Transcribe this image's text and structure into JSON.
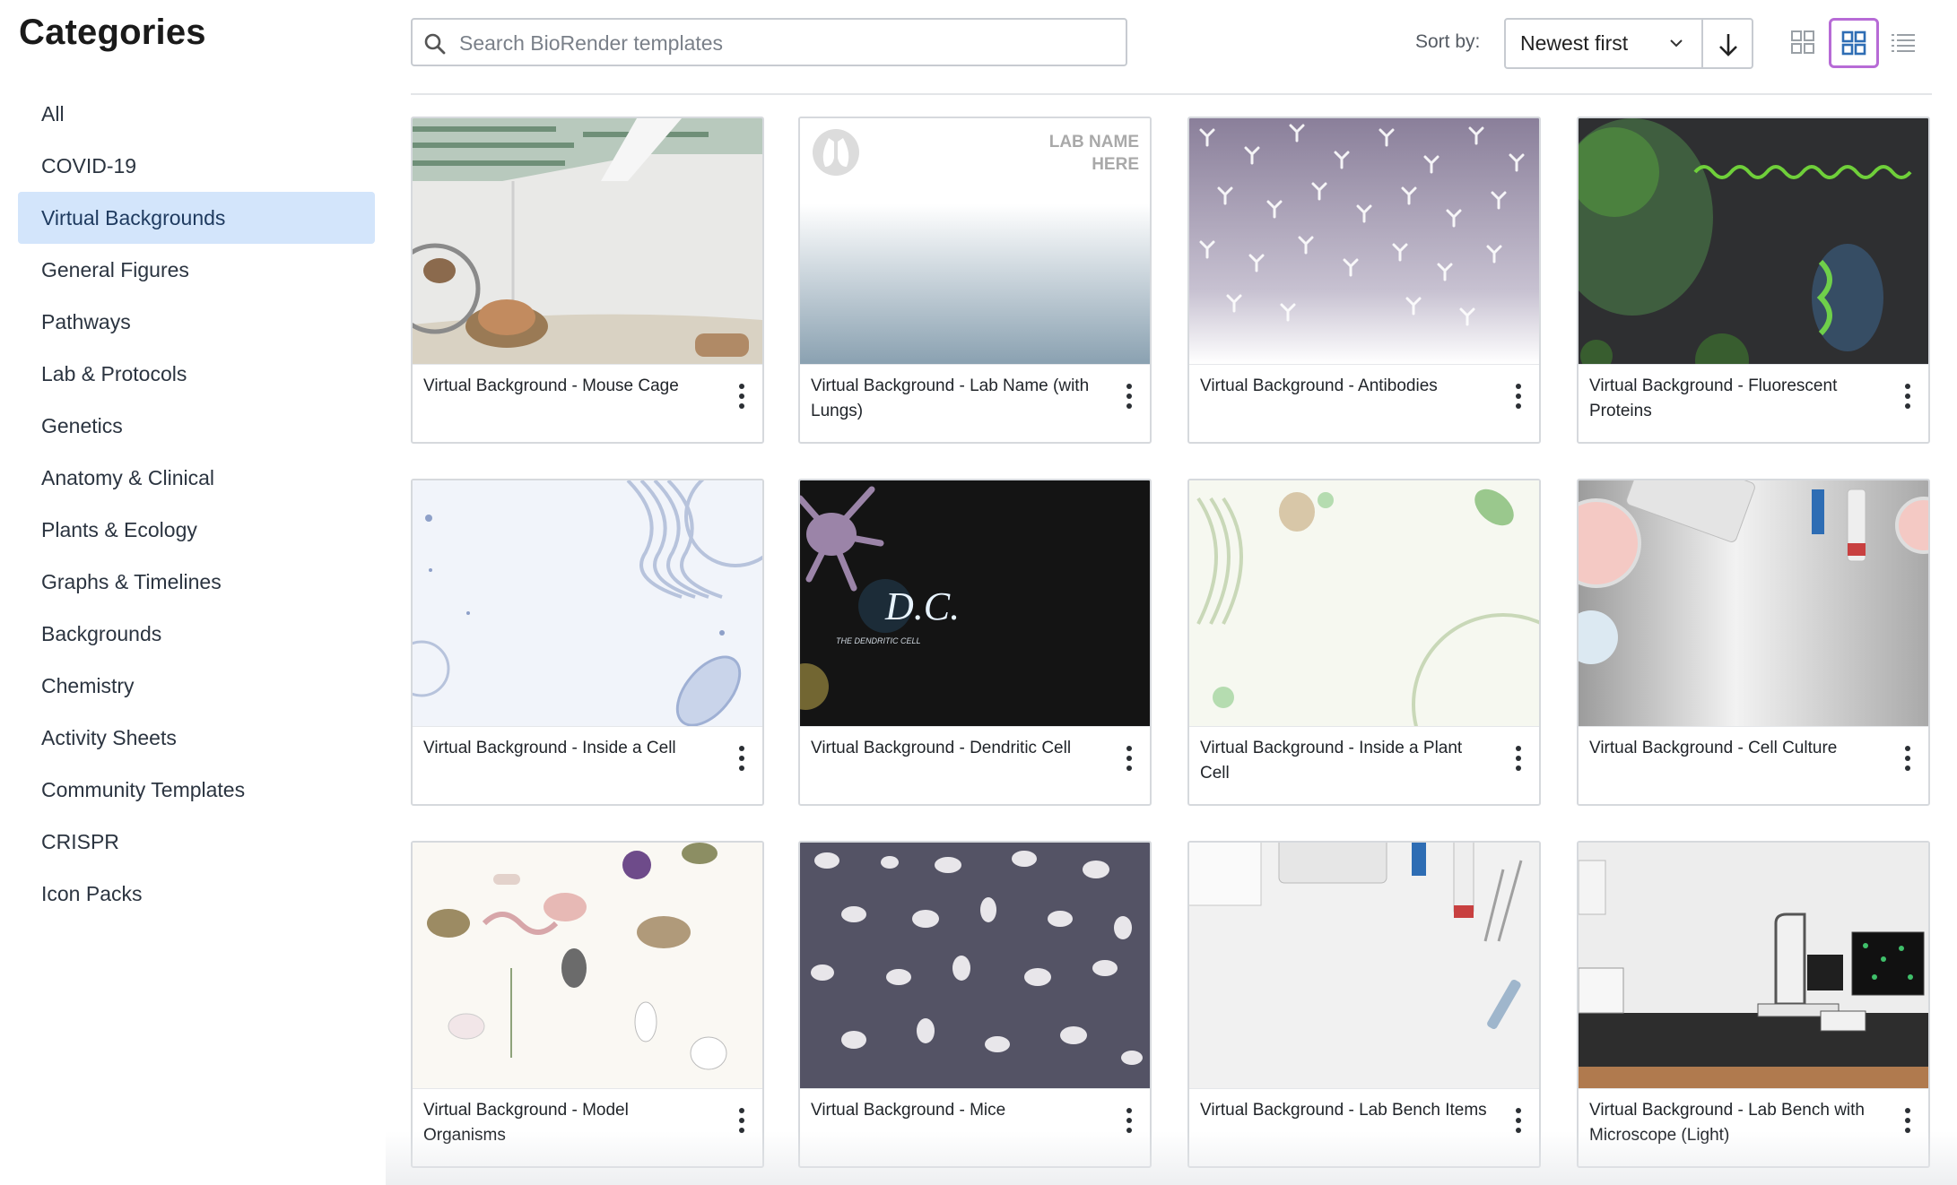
{
  "sidebar": {
    "title": "Categories",
    "items": [
      {
        "label": "All",
        "active": false
      },
      {
        "label": "COVID-19",
        "active": false
      },
      {
        "label": "Virtual Backgrounds",
        "active": true
      },
      {
        "label": "General Figures",
        "active": false
      },
      {
        "label": "Pathways",
        "active": false
      },
      {
        "label": "Lab & Protocols",
        "active": false
      },
      {
        "label": "Genetics",
        "active": false
      },
      {
        "label": "Anatomy & Clinical",
        "active": false
      },
      {
        "label": "Plants & Ecology",
        "active": false
      },
      {
        "label": "Graphs & Timelines",
        "active": false
      },
      {
        "label": "Backgrounds",
        "active": false
      },
      {
        "label": "Chemistry",
        "active": false
      },
      {
        "label": "Activity Sheets",
        "active": false
      },
      {
        "label": "Community Templates",
        "active": false
      },
      {
        "label": "CRISPR",
        "active": false
      },
      {
        "label": "Icon Packs",
        "active": false
      }
    ]
  },
  "toolbar": {
    "search_placeholder": "Search BioRender templates",
    "search_value": "",
    "sort_label": "Sort by:",
    "sort_value": "Newest first",
    "sort_direction": "descending",
    "view_modes": [
      "small-grid",
      "large-grid",
      "list"
    ],
    "active_view": "large-grid",
    "accent_color": "#b76bd6"
  },
  "templates": [
    {
      "title": "Virtual Background - Mouse Cage",
      "thumb": "mouse-cage"
    },
    {
      "title": "Virtual Background - Lab Name (with Lungs)",
      "thumb": "lab-name",
      "thumb_text": "LAB NAME HERE"
    },
    {
      "title": "Virtual Background - Antibodies",
      "thumb": "antibodies"
    },
    {
      "title": "Virtual Background - Fluorescent Proteins",
      "thumb": "fluorescent"
    },
    {
      "title": "Virtual Background - Inside a Cell",
      "thumb": "inside-cell"
    },
    {
      "title": "Virtual Background - Dendritic Cell",
      "thumb": "dendritic",
      "thumb_text": "D.C.",
      "thumb_subtext": "THE DENDRITIC CELL"
    },
    {
      "title": "Virtual Background - Inside a Plant Cell",
      "thumb": "plant-cell"
    },
    {
      "title": "Virtual Background - Cell Culture",
      "thumb": "cell-culture"
    },
    {
      "title": "Virtual Background - Model Organisms",
      "thumb": "model-organisms"
    },
    {
      "title": "Virtual Background - Mice",
      "thumb": "mice"
    },
    {
      "title": "Virtual Background - Lab Bench Items",
      "thumb": "lab-bench"
    },
    {
      "title": "Virtual Background - Lab Bench with Microscope (Light)",
      "thumb": "microscope"
    }
  ]
}
